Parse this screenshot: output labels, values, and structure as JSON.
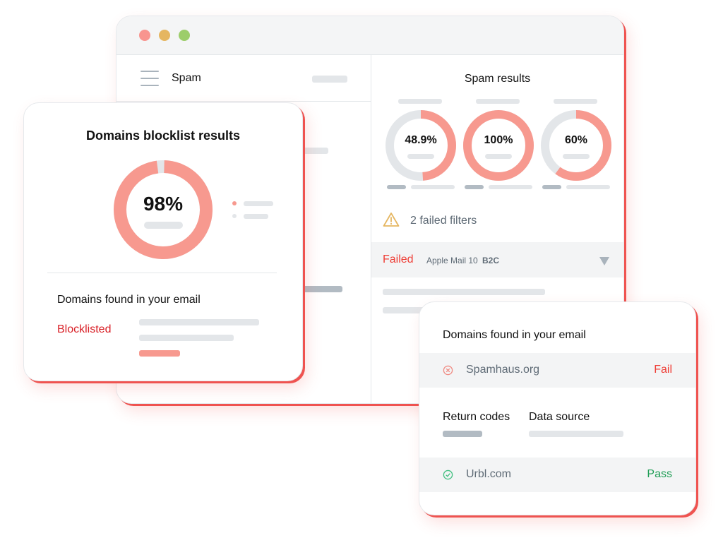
{
  "window": {
    "traffic_lights": [
      {
        "name": "close",
        "color": "#f8958f"
      },
      {
        "name": "minimize",
        "color": "#e5b661"
      },
      {
        "name": "maximize",
        "color": "#9ccd6a"
      }
    ],
    "left_pane": {
      "title": "Spam",
      "menu_icon": "hamburger-icon"
    },
    "right_pane": {
      "title": "Spam results",
      "gauges": [
        {
          "label": "48.9%",
          "value": 48.9
        },
        {
          "label": "100%",
          "value": 100
        },
        {
          "label": "60%",
          "value": 60
        }
      ],
      "warning": {
        "icon": "warning-triangle-icon",
        "text": "2 failed filters"
      },
      "failed_row": {
        "status": "Failed",
        "client": "Apple Mail 10",
        "tag": "B2C",
        "toggle_icon": "chevron-down-icon"
      }
    }
  },
  "blocklist_card": {
    "title": "Domains blocklist results",
    "donut": {
      "label": "98%",
      "value": 98
    },
    "section_title": "Domains found in your email",
    "status_label": "Blocklisted"
  },
  "domains_card": {
    "title": "Domains found in your email",
    "rows": [
      {
        "domain": "Spamhaus.org",
        "status": "Fail",
        "icon": "x-circle-icon"
      },
      {
        "domain": "Urbl.com",
        "status": "Pass",
        "icon": "check-circle-icon"
      }
    ],
    "columns": {
      "return_codes": "Return codes",
      "data_source": "Data source"
    }
  },
  "colors": {
    "accent_red": "#f7998f",
    "fail_red": "#ef3e36",
    "blocklisted_red": "#d92027",
    "pass_green": "#1f9d55",
    "track_gray": "#e3e6e9",
    "warning_amber": "#e5b661"
  }
}
